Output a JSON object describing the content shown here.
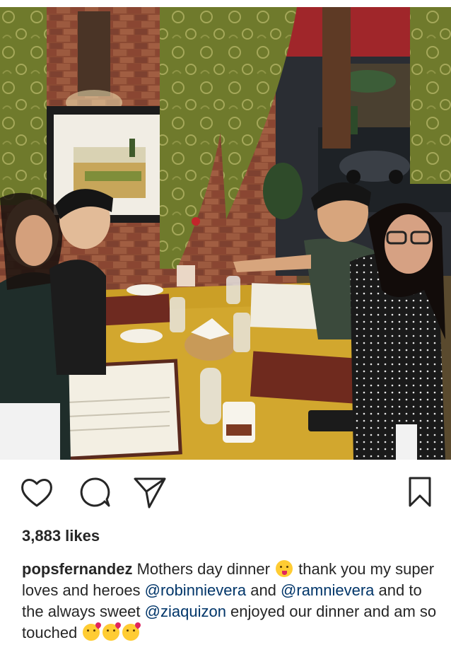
{
  "post": {
    "photo_alt": "",
    "likes_text": "3,883 likes",
    "caption": {
      "username": "popsfernandez",
      "text_1": " Mothers day dinner ",
      "emoji_1": "goofy-face-emoji",
      "text_2": " thank you my super loves and heroes ",
      "mention_1": "@robinnievera",
      "text_3": " and ",
      "mention_2": "@ramnievera",
      "text_4": " and to the always sweet ",
      "mention_3": "@ziaquizon",
      "text_5": " enjoyed our dinner and am so touched ",
      "emoji_2": "kissing-face-emoji"
    }
  },
  "actions": {
    "like_icon": "heart-icon",
    "comment_icon": "comment-icon",
    "share_icon": "send-icon",
    "save_icon": "bookmark-icon"
  },
  "colors": {
    "text": "#262626",
    "mention": "#003569",
    "background": "#ffffff"
  }
}
